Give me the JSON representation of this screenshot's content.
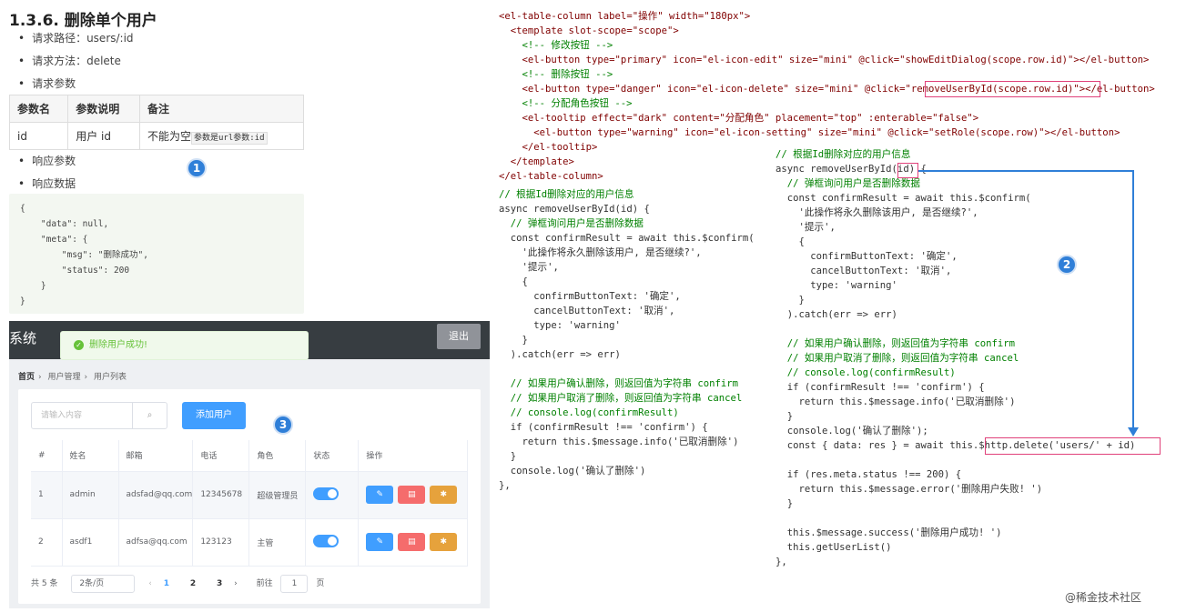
{
  "doc": {
    "title": "1.3.6. 删除单个用户",
    "req_path": "请求路径：users/:id",
    "req_method": "请求方法：delete",
    "req_params": "请求参数",
    "table": {
      "headers": [
        "参数名",
        "参数说明",
        "备注"
      ],
      "row": [
        "id",
        "用户 id",
        "不能为空"
      ],
      "note_code": "参数是url参数:id"
    },
    "resp_params": "响应参数",
    "resp_data": "响应数据",
    "json_lines": [
      "{",
      "    \"data\": null,",
      "    \"meta\": {",
      "        \"msg\": \"删除成功\",",
      "        \"status\": 200",
      "    }",
      "}"
    ]
  },
  "badges": [
    "1",
    "2",
    "3"
  ],
  "app": {
    "system_title": "系统",
    "exit_label": "退出",
    "toast": "删除用户成功!",
    "breadcrumb": [
      "首页",
      "用户管理",
      "用户列表"
    ],
    "search_placeholder": "请输入内容",
    "add_user_label": "添加用户",
    "columns": [
      "#",
      "姓名",
      "邮箱",
      "电话",
      "角色",
      "状态",
      "操作"
    ],
    "rows": [
      {
        "idx": "1",
        "name": "admin",
        "email": "adsfad@qq.com",
        "phone": "12345678",
        "role": "超级管理员"
      },
      {
        "idx": "2",
        "name": "asdf1",
        "email": "adfsa@qq.com",
        "phone": "123123",
        "role": "主管"
      }
    ],
    "pager": {
      "total": "共 5 条",
      "size": "2条/页",
      "pages": [
        "1",
        "2",
        "3"
      ],
      "goto": "前往",
      "goto_value": "1",
      "page_unit": "页"
    }
  },
  "code_top": [
    "<el-table-column label=\"操作\" width=\"180px\">",
    "  <template slot-scope=\"scope\">",
    "    <!-- 修改按钮 -->",
    "    <el-button type=\"primary\" icon=\"el-icon-edit\" size=\"mini\" @click=\"showEditDialog(scope.row.id)\"></el-button>",
    "    <!-- 删除按钮 -->",
    "    <el-button type=\"danger\" icon=\"el-icon-delete\" size=\"mini\" @click=\"removeUserById(scope.row.id)\"></el-button>",
    "    <!-- 分配角色按钮 -->",
    "    <el-tooltip effect=\"dark\" content=\"分配角色\" placement=\"top\" :enterable=\"false\">",
    "      <el-button type=\"warning\" icon=\"el-icon-setting\" size=\"mini\" @click=\"setRole(scope.row)\"></el-button>",
    "    </el-tooltip>",
    "  </template>",
    "</el-table-column>"
  ],
  "code_left": [
    "// 根据Id删除对应的用户信息",
    "async removeUserById(id) {",
    "  // 弹框询问用户是否删除数据",
    "  const confirmResult = await this.$confirm(",
    "    '此操作将永久删除该用户, 是否继续?',",
    "    '提示',",
    "    {",
    "      confirmButtonText: '确定',",
    "      cancelButtonText: '取消',",
    "      type: 'warning'",
    "    }",
    "  ).catch(err => err)",
    "",
    "  // 如果用户确认删除，则返回值为字符串 confirm",
    "  // 如果用户取消了删除，则返回值为字符串 cancel",
    "  // console.log(confirmResult)",
    "  if (confirmResult !== 'confirm') {",
    "    return this.$message.info('已取消删除')",
    "  }",
    "  console.log('确认了删除')",
    "},"
  ],
  "code_right": [
    "// 根据Id删除对应的用户信息",
    "async removeUserById(id) {",
    "  // 弹框询问用户是否删除数据",
    "  const confirmResult = await this.$confirm(",
    "    '此操作将永久删除该用户, 是否继续?',",
    "    '提示',",
    "    {",
    "      confirmButtonText: '确定',",
    "      cancelButtonText: '取消',",
    "      type: 'warning'",
    "    }",
    "  ).catch(err => err)",
    "",
    "  // 如果用户确认删除，则返回值为字符串 confirm",
    "  // 如果用户取消了删除，则返回值为字符串 cancel",
    "  // console.log(confirmResult)",
    "  if (confirmResult !== 'confirm') {",
    "    return this.$message.info('已取消删除')",
    "  }",
    "  console.log('确认了删除');",
    "  const { data: res } = await this.$http.delete('users/' + id)",
    "",
    "  if (res.meta.status !== 200) {",
    "    return this.$message.error('删除用户失败! ')",
    "  }",
    "",
    "  this.$message.success('删除用户成功! ')",
    "  this.getUserList()",
    "},"
  ],
  "watermark": "@稀金技术社区",
  "colors": {
    "accent": "#409eff",
    "danger": "#f56c6c",
    "warning": "#e6a23c",
    "badge": "#2f7fd8",
    "highlight_box": "#e0417a"
  }
}
